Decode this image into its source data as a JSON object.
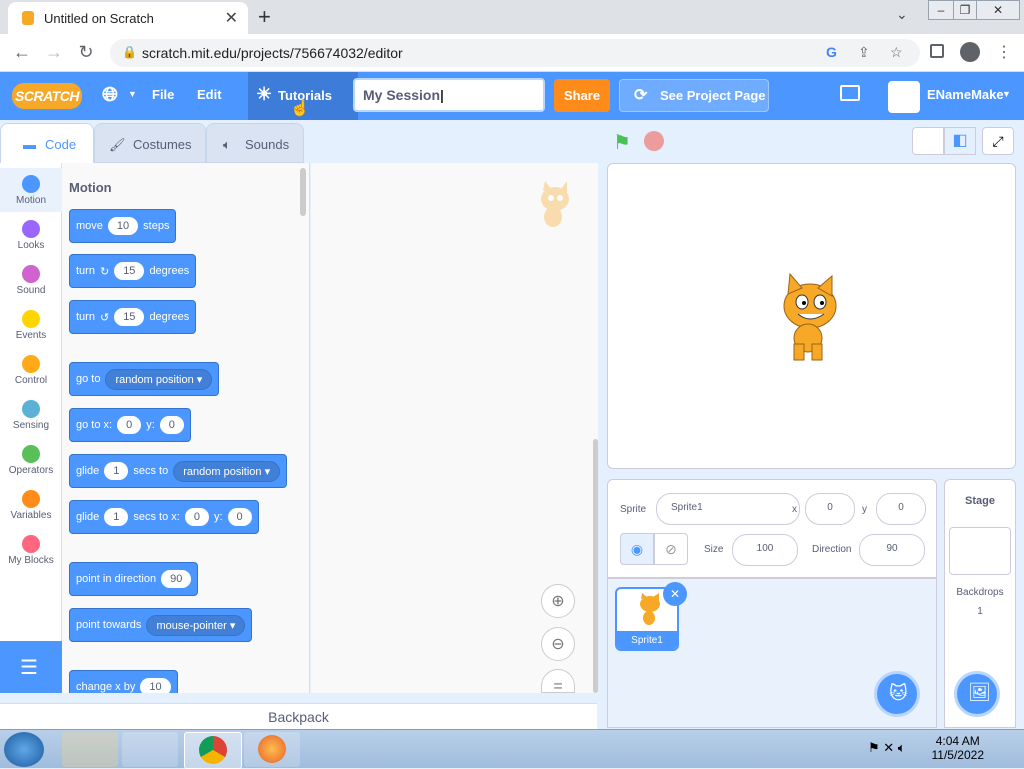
{
  "browser": {
    "tab_title": "Untitled on Scratch",
    "url": "scratch.mit.edu/projects/756674032/editor"
  },
  "menubar": {
    "logo": "SCRATCH",
    "file": "File",
    "edit": "Edit",
    "tutorials": "Tutorials",
    "project_title": "My Session",
    "share": "Share",
    "see_project_page": "See Project Page",
    "username": "ENameMake"
  },
  "editor_tabs": {
    "code": "Code",
    "costumes": "Costumes",
    "sounds": "Sounds"
  },
  "categories": [
    {
      "label": "Motion",
      "color": "#4c97ff"
    },
    {
      "label": "Looks",
      "color": "#9966ff"
    },
    {
      "label": "Sound",
      "color": "#cf63cf"
    },
    {
      "label": "Events",
      "color": "#ffd500"
    },
    {
      "label": "Control",
      "color": "#ffab19"
    },
    {
      "label": "Sensing",
      "color": "#5cb1d6"
    },
    {
      "label": "Operators",
      "color": "#59c059"
    },
    {
      "label": "Variables",
      "color": "#ff8c1a"
    },
    {
      "label": "My Blocks",
      "color": "#ff6680"
    }
  ],
  "palette": {
    "heading": "Motion",
    "move": {
      "pre": "move",
      "val": "10",
      "post": "steps"
    },
    "turn_right": {
      "pre": "turn",
      "val": "15",
      "post": "degrees"
    },
    "turn_left": {
      "pre": "turn",
      "val": "15",
      "post": "degrees"
    },
    "goto": {
      "pre": "go to",
      "menu": "random position"
    },
    "goto_xy": {
      "pre": "go to x:",
      "x": "0",
      "ylabel": "y:",
      "y": "0"
    },
    "glide_to": {
      "pre": "glide",
      "val": "1",
      "mid": "secs to",
      "menu": "random position"
    },
    "glide_xy": {
      "pre": "glide",
      "val": "1",
      "mid": "secs to x:",
      "x": "0",
      "ylabel": "y:",
      "y": "0"
    },
    "point_dir": {
      "pre": "point in direction",
      "val": "90"
    },
    "point_towards": {
      "pre": "point towards",
      "menu": "mouse-pointer"
    },
    "change_x": {
      "pre": "change x by",
      "val": "10"
    }
  },
  "backpack": "Backpack",
  "sprite_info": {
    "sprite_label": "Sprite",
    "sprite_name": "Sprite1",
    "x_label": "x",
    "x": "0",
    "y_label": "y",
    "y": "0",
    "size_label": "Size",
    "size": "100",
    "direction_label": "Direction",
    "direction": "90"
  },
  "sprite_list": [
    {
      "name": "Sprite1"
    }
  ],
  "stage_panel": {
    "title": "Stage",
    "backdrops_label": "Backdrops",
    "backdrops_count": "1"
  },
  "taskbar": {
    "time": "4:04 AM",
    "date": "11/5/2022"
  }
}
